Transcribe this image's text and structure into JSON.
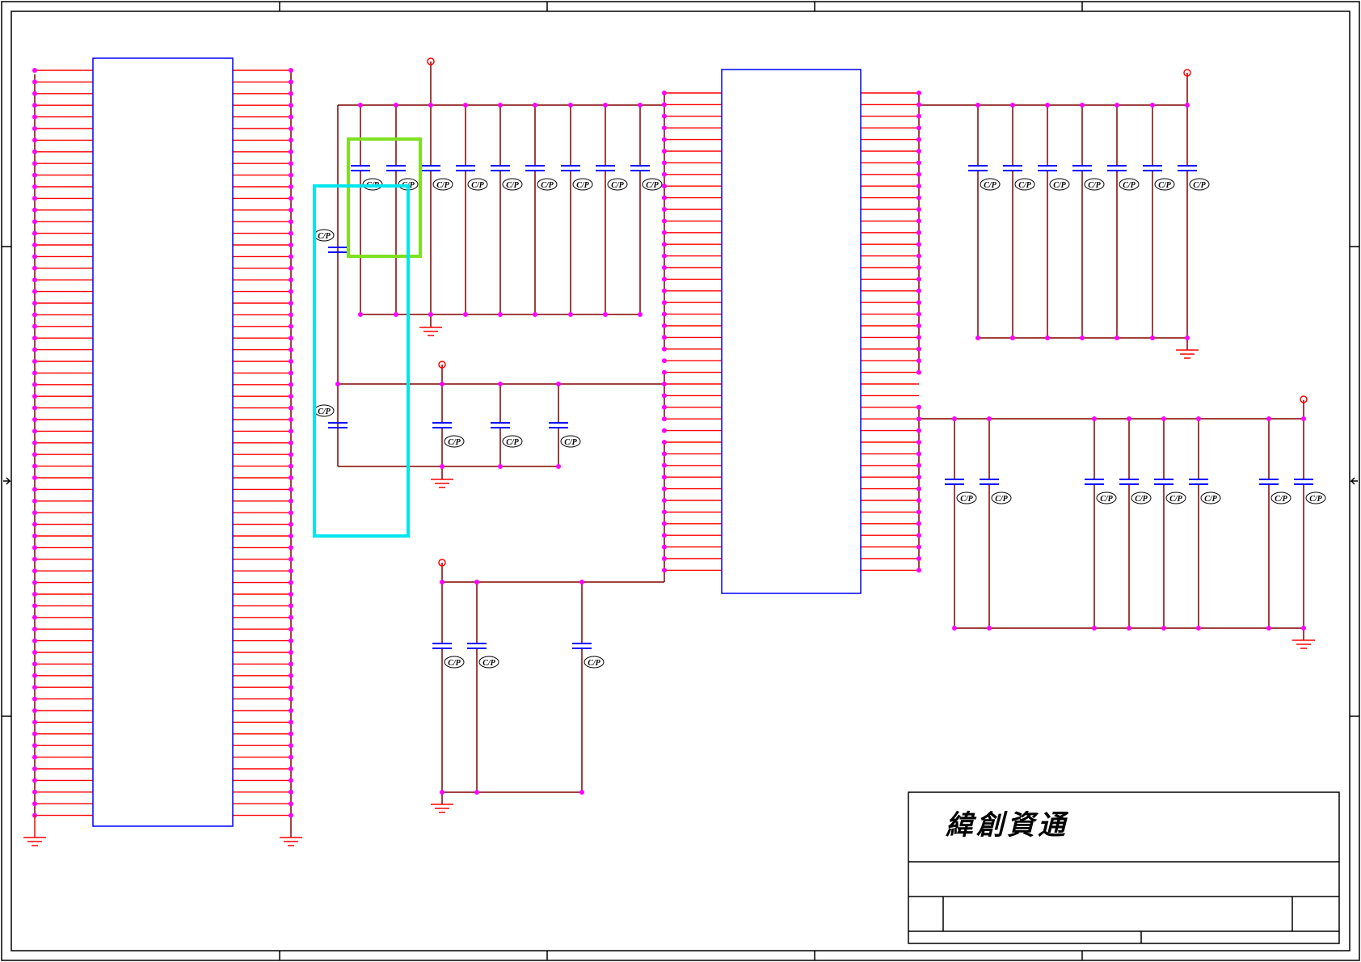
{
  "title_block": {
    "company_name": "緯創資通"
  },
  "capacitor_label": "C/P",
  "colors": {
    "border": "#000000",
    "ic_body": "#0000ff",
    "pin": "#ff0000",
    "net": "#800000",
    "junction": "#ff00ff",
    "capacitor": "#0000ff",
    "supply": "#ff0000",
    "highlight_green": "#7ee021",
    "highlight_cyan": "#00e5ee"
  }
}
